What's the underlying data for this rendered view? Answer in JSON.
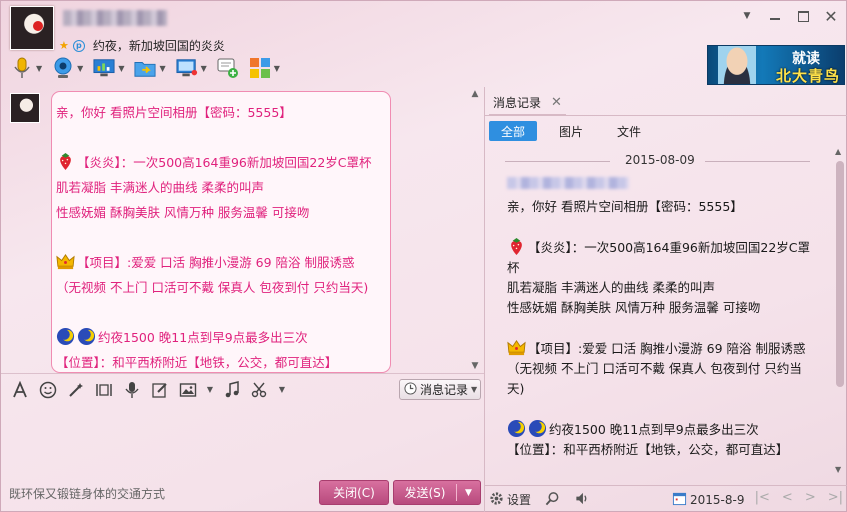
{
  "header": {
    "nickname": "",
    "signature": "约夜，新加坡回国的炎炎"
  },
  "ad": {
    "line1": "就读",
    "line2": "北大青鸟"
  },
  "chat": {
    "lines": [
      "亲，你好 看照片空间相册【密码：5555】",
      "",
      "【炎炎】：一次500高164重96新加坡回国22岁C罩杯",
      "肌若凝脂  丰满迷人的曲线  柔柔的叫声",
      "性感妩媚 酥胸美肤  风情万种 服务温馨  可接吻",
      "",
      "【项目】:爱爱 口活 胸推小漫游 69 陪浴 制服诱惑",
      "（无视频 不上门 口活可不戴 保真人 包夜到付 只约当天)",
      "",
      "约夜1500 晚11点到早9点最多出三次",
      "【位置】：和平西桥附近【地铁，公交，都可直达】"
    ]
  },
  "input": {
    "msg_record_label": "消息记录",
    "tip": "既环保又锻链身体的交通方式",
    "close_label": "关闭(C)",
    "send_label": "发送(S)"
  },
  "right_panel": {
    "tab_label": "消息记录",
    "filters": [
      "全部",
      "图片",
      "文件"
    ],
    "date_header": "2015-08-09",
    "history": [
      "亲，你好 看照片空间相册【密码：5555】",
      "",
      "【炎炎】：一次500高164重96新加坡回国22岁C罩杯",
      "肌若凝脂  丰满迷人的曲线  柔柔的叫声",
      "性感妩媚 酥胸美肤  风情万种 服务温馨  可接吻",
      "",
      "【项目】:爱爱 口活 胸推小漫游 69 陪浴 制服诱惑",
      "（无视频 不上门 口活可不戴 保真人 包夜到付 只约当天)",
      "",
      "约夜1500 晚11点到早9点最多出三次",
      "【位置】：和平西桥附近【地铁，公交，都可直达】"
    ],
    "settings_label": "设置",
    "date_picker_value": "2015-8-9"
  },
  "colors": {
    "accent_pink": "#e0227d",
    "filter_active": "#2f8fe0",
    "button_pink": "#c85a8c"
  }
}
